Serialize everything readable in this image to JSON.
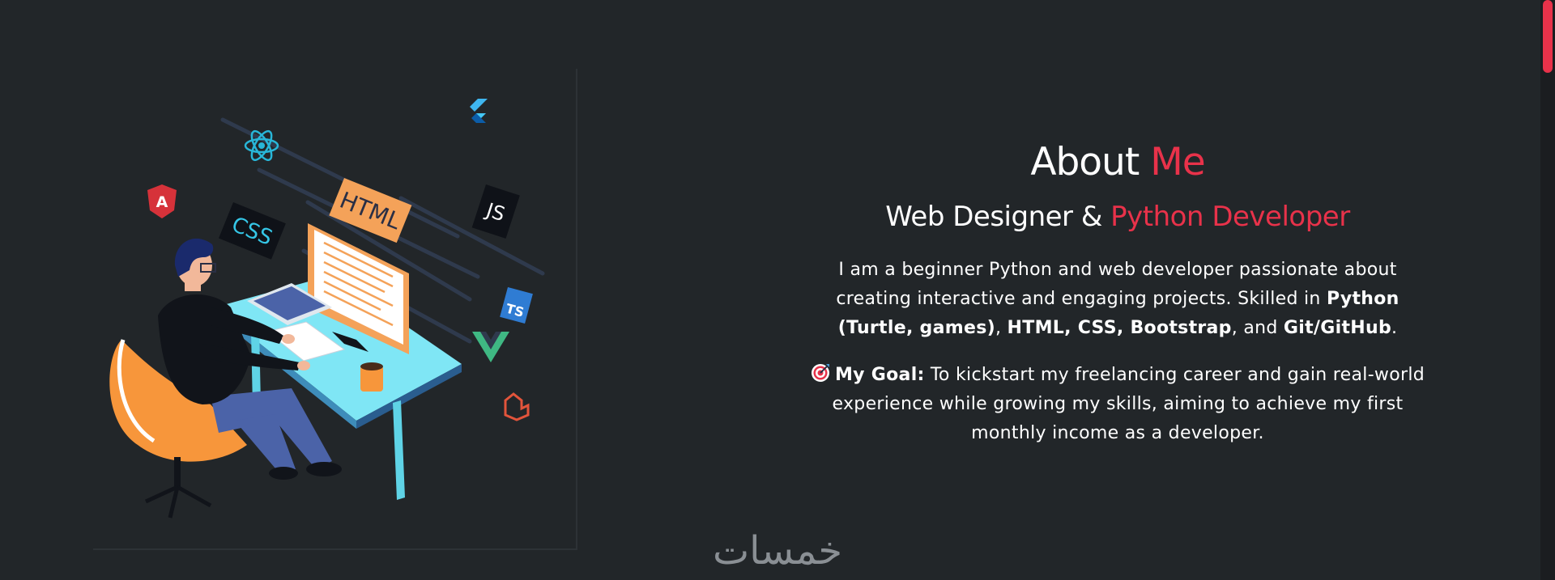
{
  "about": {
    "heading_prefix": "About ",
    "heading_accent": "Me",
    "subtitle_prefix": "Web Designer & ",
    "subtitle_accent": "Python Developer",
    "bio": {
      "t1": "I am a beginner Python and web developer passionate about creating interactive and engaging projects. Skilled in ",
      "b1": "Python (Turtle, games)",
      "t2": ", ",
      "b2": "HTML, CSS, Bootstrap",
      "t3": ", and ",
      "b3": "Git/GitHub",
      "t4": "."
    },
    "goal": {
      "label": "My Goal:",
      "text": " To kickstart my freelancing career and gain real-world experience while growing my skills, aiming to achieve my first monthly income as a developer."
    }
  },
  "illustration": {
    "badge_html": "HTML",
    "badge_css": "CSS",
    "badge_js": "JS",
    "badge_ts": "TS",
    "badge_angular": "A"
  },
  "watermark": {
    "text": "خمسات"
  },
  "colors": {
    "background": "#222629",
    "accent": "#e8324a",
    "text": "#ffffff",
    "chair": "#f7963b",
    "desk": "#7fe6f5",
    "html_badge": "#f4a259"
  },
  "scrollbar": {
    "position_fraction": 0.0
  }
}
